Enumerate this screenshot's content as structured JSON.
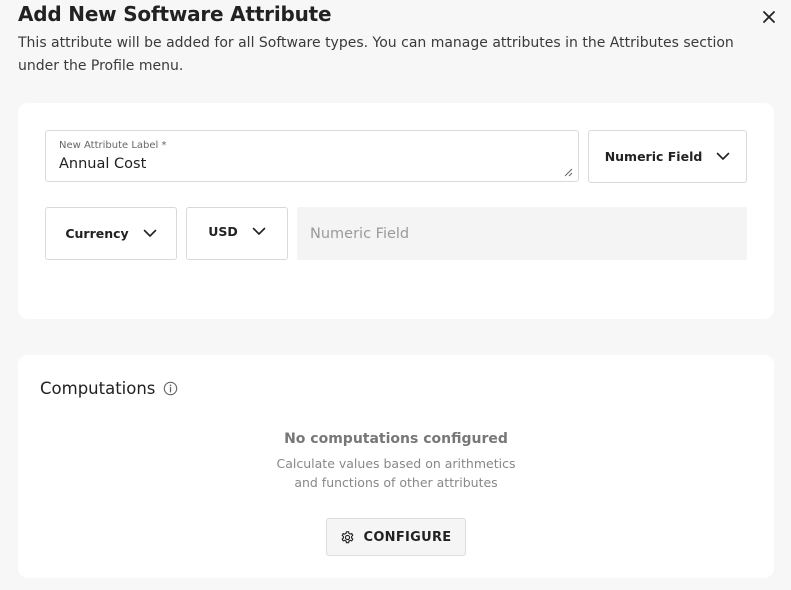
{
  "dialog": {
    "title": "Add New Software Attribute",
    "subtitle": "This attribute will be added for all Software types. You can manage attributes in the Attributes section under the Profile menu."
  },
  "attribute_form": {
    "label_field": {
      "label": "New Attribute Label *",
      "value": "Annual Cost"
    },
    "field_type": {
      "selected": "Numeric Field"
    },
    "unit_type": {
      "selected": "Currency"
    },
    "currency_code": {
      "selected": "USD"
    },
    "value_field": {
      "placeholder": "Numeric Field"
    }
  },
  "computations": {
    "title": "Computations",
    "empty_title": "No computations configured",
    "empty_description_line1": "Calculate values based on arithmetics",
    "empty_description_line2": "and functions of other attributes",
    "configure_label": "CONFIGURE"
  },
  "icons": {
    "close": "close-icon",
    "chevron": "chevron-down-icon",
    "info": "info-icon",
    "gear": "gear-icon",
    "resize": "resize-grip-icon"
  },
  "colors": {
    "background": "#f7f7f7",
    "card": "#ffffff",
    "border": "#d9d9d9",
    "text_primary": "#222222",
    "text_muted": "#888888"
  }
}
